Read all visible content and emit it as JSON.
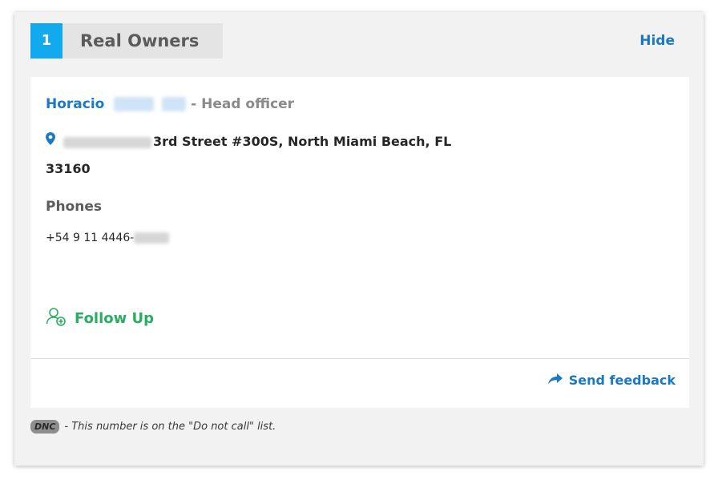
{
  "section": {
    "number": "1",
    "title": "Real Owners",
    "hide_label": "Hide"
  },
  "owner": {
    "first_name": "Horacio",
    "role_separator": " - ",
    "role": "Head officer",
    "address_line1": "3rd Street #300S, North Miami Beach, FL",
    "address_line2": "33160"
  },
  "phones": {
    "heading": "Phones",
    "items": [
      "+54 9 11 4446-"
    ]
  },
  "actions": {
    "follow_up_label": "Follow Up",
    "send_feedback_label": "Send feedback"
  },
  "dnc": {
    "badge": "DNC",
    "note": "- This number is on the \"Do not call\" list."
  },
  "icons": {
    "location": "map-pin-icon",
    "follow_up": "user-add-icon",
    "feedback": "share-arrow-icon"
  },
  "colors": {
    "accent_blue": "#12a9ee",
    "link_blue": "#1a79c2",
    "follow_up_green": "#27ae60",
    "panel_bg": "#f2f2f2"
  }
}
